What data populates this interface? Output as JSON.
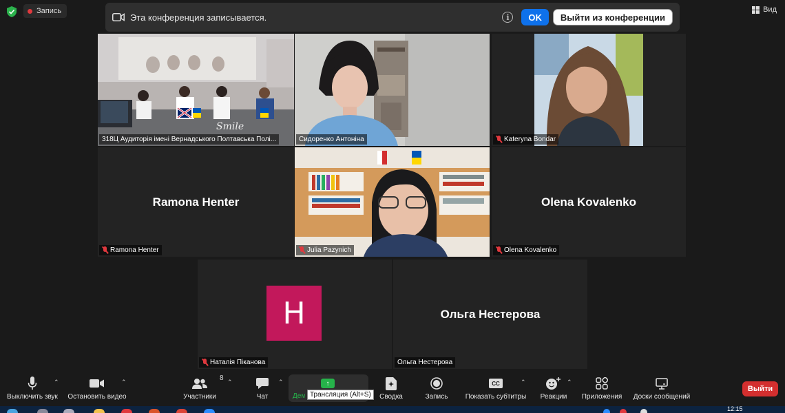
{
  "topbar": {
    "record_label": "Запись",
    "view_label": "Вид"
  },
  "banner": {
    "text": "Эта конференция записывается.",
    "info_glyph": "i",
    "ok_label": "OK",
    "leave_label": "Выйти из конференции"
  },
  "tiles": [
    {
      "name": "318Ц Аудиторія імені Вернадського Полтавська Полі...",
      "centered": "",
      "muted": false,
      "video": true
    },
    {
      "name": "Сидоренко Антоніна",
      "centered": "",
      "muted": false,
      "video": true
    },
    {
      "name": "Kateryna Bondar",
      "centered": "",
      "muted": true,
      "video": true
    },
    {
      "name": "Ramona Henter",
      "centered": "Ramona Henter",
      "muted": true,
      "video": false
    },
    {
      "name": "Julia Pazynich",
      "centered": "",
      "muted": true,
      "video": true
    },
    {
      "name": "Olena Kovalenko",
      "centered": "Olena Kovalenko",
      "muted": true,
      "video": false
    },
    {
      "name": "Наталія Піканова",
      "centered": "",
      "avatar_letter": "H",
      "muted": true,
      "video": false
    },
    {
      "name": "Ольга Нестерова",
      "centered": "Ольга Нестерова",
      "muted": false,
      "video": false
    }
  ],
  "toolbar": {
    "mute_label": "Выключить звук",
    "video_label": "Остановить видео",
    "participants_label": "Участники",
    "participants_count": "8",
    "chat_label": "Чат",
    "share_label": "Демонстрация экрана",
    "share_tooltip": "Трансляция (Alt+S)",
    "summary_label": "Сводка",
    "record_label": "Запись",
    "captions_label": "Показать субтитры",
    "captions_badge": "CC",
    "reactions_label": "Реакции",
    "apps_label": "Приложения",
    "whiteboards_label": "Доски сообщений",
    "leave_label": "Выйти"
  },
  "taskbar": {
    "clock": "12:15"
  },
  "colors": {
    "accent_blue": "#0e71eb",
    "active_speaker": "#d8e04a",
    "leave_red": "#d32f2f",
    "share_green": "#26b34a",
    "avatar_magenta": "#c2185b"
  }
}
